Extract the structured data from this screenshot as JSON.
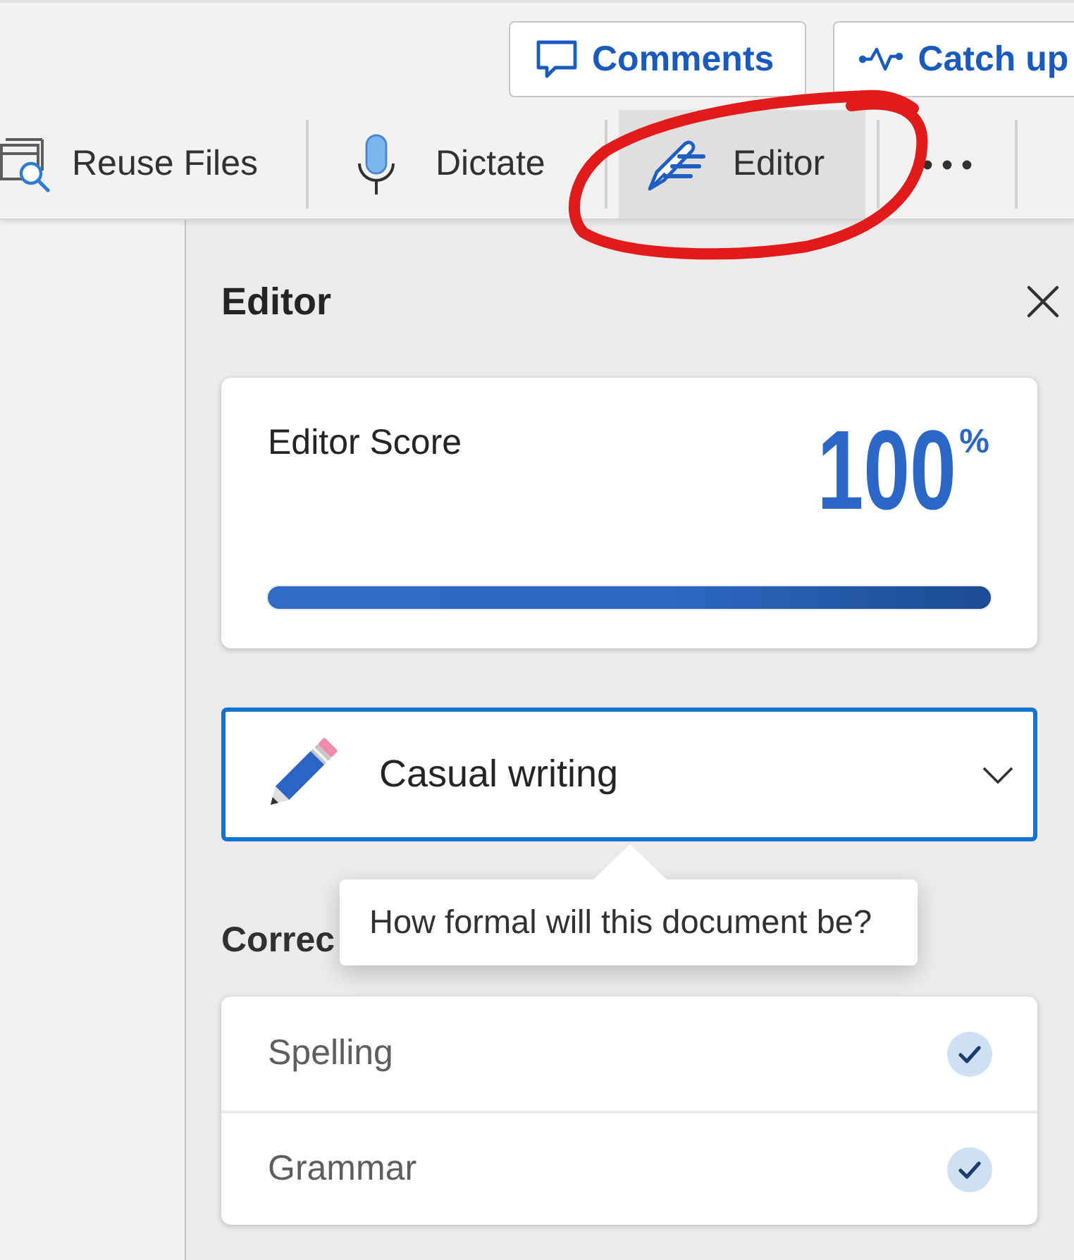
{
  "header": {
    "buttons": [
      {
        "label": "Comments"
      },
      {
        "label": "Catch up"
      }
    ]
  },
  "ribbon": {
    "items": [
      {
        "label": "Reuse Files",
        "selected": false
      },
      {
        "label": "Dictate",
        "selected": false
      },
      {
        "label": "Editor",
        "selected": true
      }
    ]
  },
  "editor_pane": {
    "title": "Editor",
    "score": {
      "label": "Editor Score",
      "value": "100",
      "unit": "%",
      "level": 1
    },
    "writing_style": {
      "value": "Casual writing",
      "tooltip": "How formal will this document be?"
    },
    "corrections": {
      "heading": "Correc",
      "items": [
        {
          "label": "Spelling",
          "checked": true
        },
        {
          "label": "Grammar",
          "checked": true
        }
      ]
    }
  }
}
